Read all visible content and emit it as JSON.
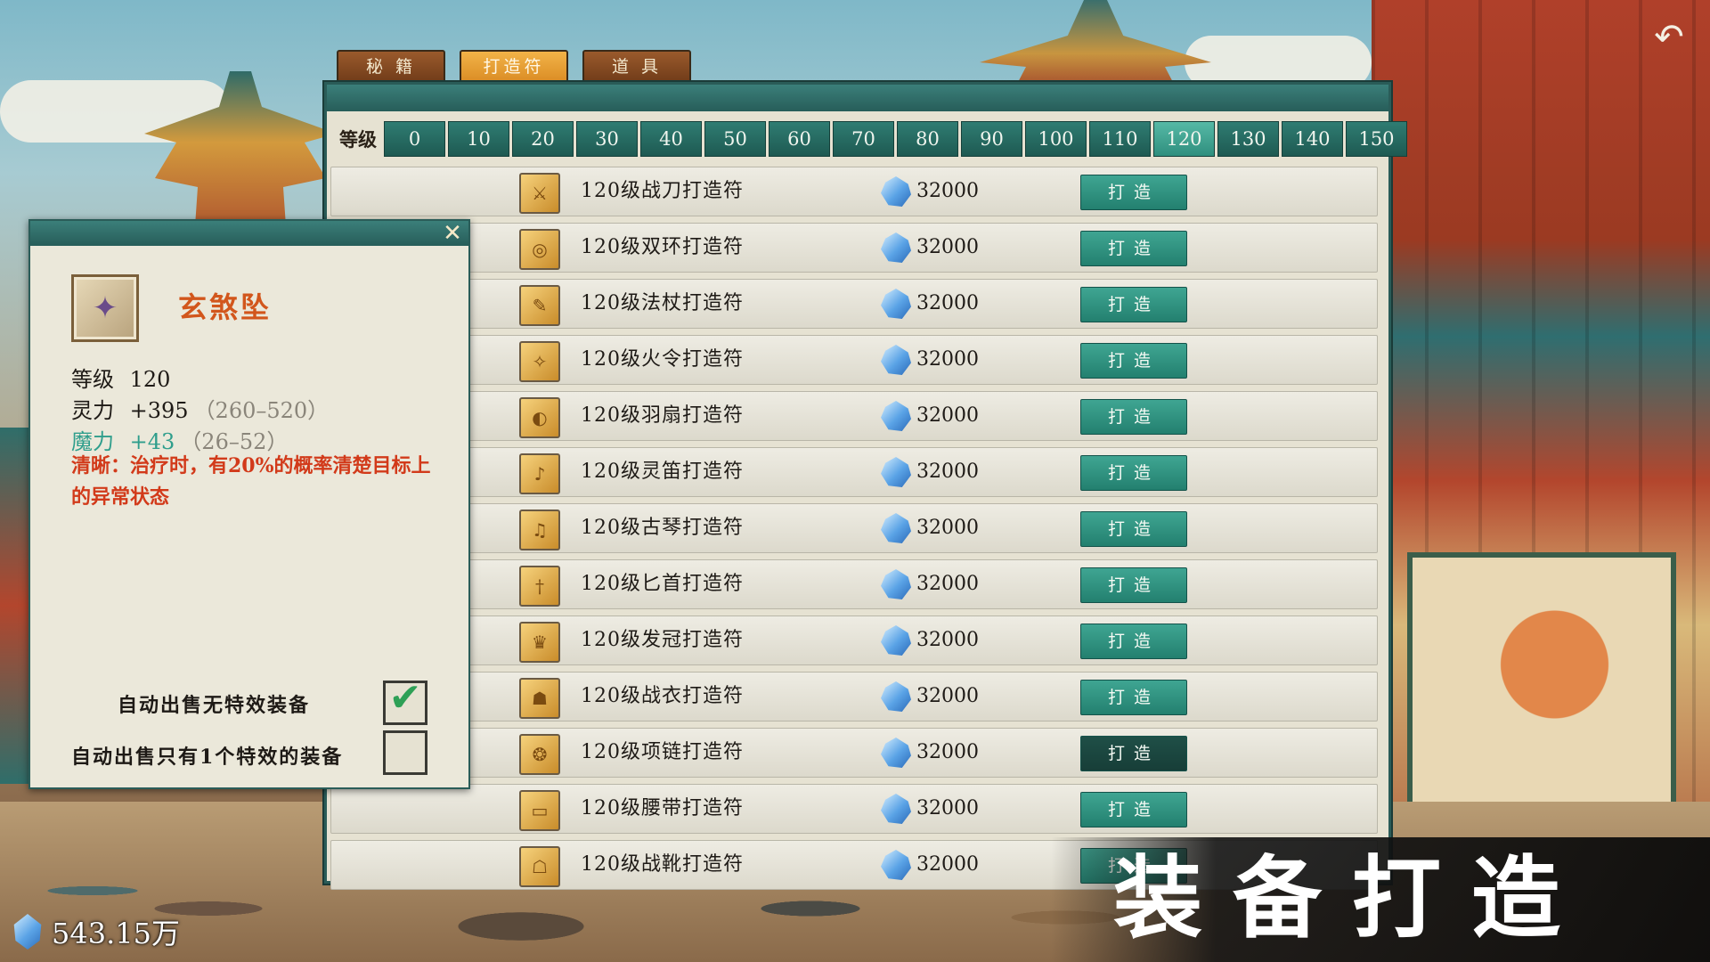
{
  "tabs": [
    {
      "label": "秘 籍",
      "active": false
    },
    {
      "label": "打造符",
      "active": true
    },
    {
      "label": "道 具",
      "active": false
    }
  ],
  "level_filter": {
    "label": "等级",
    "levels": [
      "0",
      "10",
      "20",
      "30",
      "40",
      "50",
      "60",
      "70",
      "80",
      "90",
      "100",
      "110",
      "120",
      "130",
      "140",
      "150"
    ],
    "selected": "120"
  },
  "forge_list": [
    {
      "name": "120级战刀打造符",
      "cost": "32000",
      "button": "打造",
      "icon": "blade-talisman-icon"
    },
    {
      "name": "120级双环打造符",
      "cost": "32000",
      "button": "打造",
      "icon": "rings-talisman-icon"
    },
    {
      "name": "120级法杖打造符",
      "cost": "32000",
      "button": "打造",
      "icon": "staff-talisman-icon"
    },
    {
      "name": "120级火令打造符",
      "cost": "32000",
      "button": "打造",
      "icon": "fire-token-talisman-icon"
    },
    {
      "name": "120级羽扇打造符",
      "cost": "32000",
      "button": "打造",
      "icon": "feather-fan-talisman-icon"
    },
    {
      "name": "120级灵笛打造符",
      "cost": "32000",
      "button": "打造",
      "icon": "flute-talisman-icon"
    },
    {
      "name": "120级古琴打造符",
      "cost": "32000",
      "button": "打造",
      "icon": "guqin-talisman-icon"
    },
    {
      "name": "120级匕首打造符",
      "cost": "32000",
      "button": "打造",
      "icon": "dagger-talisman-icon"
    },
    {
      "name": "120级发冠打造符",
      "cost": "32000",
      "button": "打造",
      "icon": "crown-talisman-icon"
    },
    {
      "name": "120级战衣打造符",
      "cost": "32000",
      "button": "打造",
      "icon": "armor-talisman-icon"
    },
    {
      "name": "120级项链打造符",
      "cost": "32000",
      "button": "打造",
      "icon": "necklace-talisman-icon"
    },
    {
      "name": "120级腰带打造符",
      "cost": "32000",
      "button": "打造",
      "icon": "belt-talisman-icon"
    },
    {
      "name": "120级战靴打造符",
      "cost": "32000",
      "button": "打造",
      "icon": "boots-talisman-icon"
    }
  ],
  "item_popup": {
    "name": "玄煞坠",
    "icon": "pendant-icon",
    "level_label": "等级",
    "level_value": "120",
    "stat1_label": "灵力",
    "stat1_value": "+395",
    "stat1_range": "（260–520）",
    "stat2_label": "魔力",
    "stat2_value": "+43",
    "stat2_range": "（26–52）",
    "effect": "清晰：治疗时，有20%的概率清楚目标上的异常状态",
    "auto_sell_1": "自动出售无特效装备",
    "auto_sell_1_checked": true,
    "auto_sell_2": "自动出售只有1个特效的装备",
    "auto_sell_2_checked": false
  },
  "currency": {
    "icon": "crystal-icon",
    "value": "543.15万"
  },
  "caption": "装备打造",
  "colors": {
    "teal_button": "#2f8f7e",
    "tab_active": "#e59a2c",
    "effect_text": "#d23a1a",
    "item_name": "#d2561c",
    "magic_stat": "#2f9e8c"
  }
}
